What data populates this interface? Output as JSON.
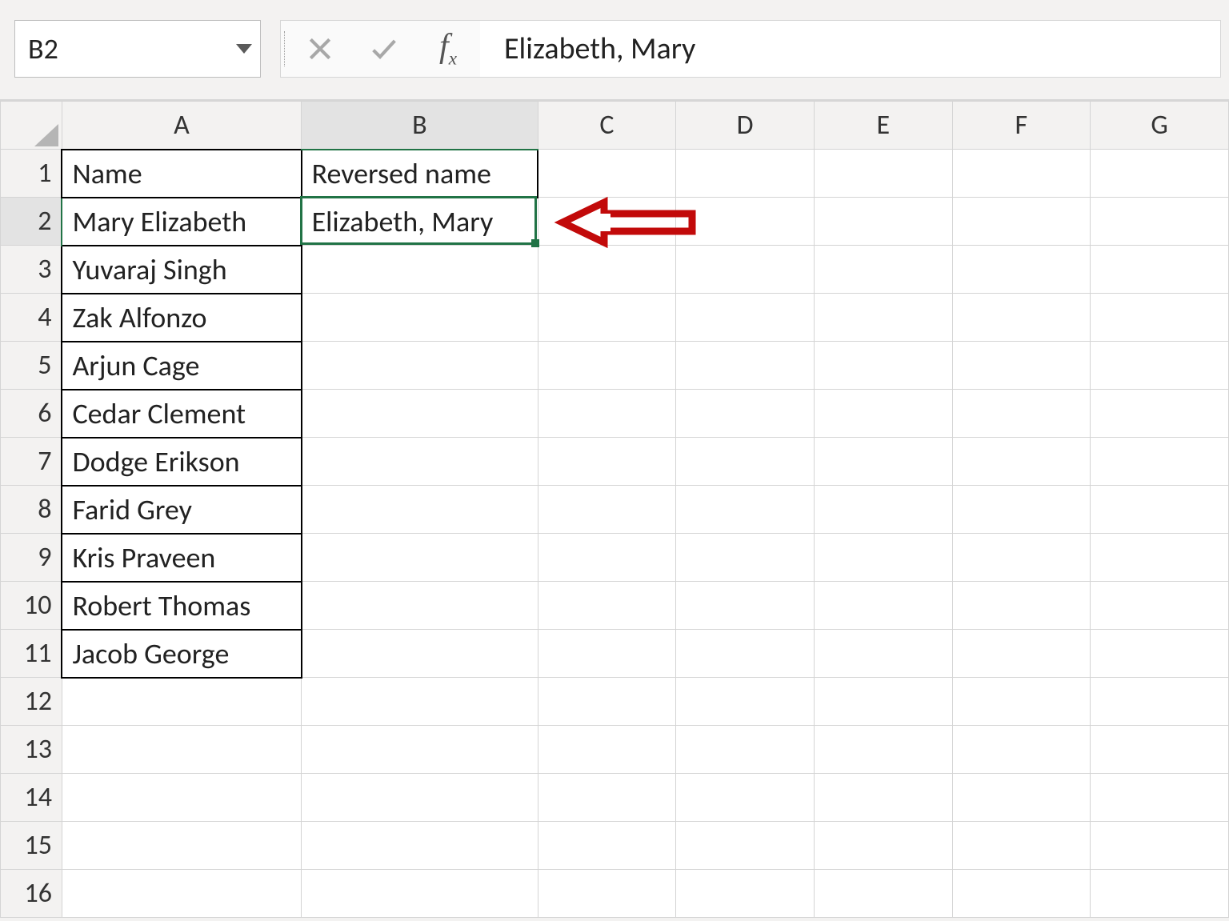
{
  "namebox": {
    "value": "B2"
  },
  "formula": {
    "value": "Elizabeth, Mary"
  },
  "columns": [
    "A",
    "B",
    "C",
    "D",
    "E",
    "F",
    "G"
  ],
  "rows": [
    1,
    2,
    3,
    4,
    5,
    6,
    7,
    8,
    9,
    10,
    11,
    12,
    13,
    14,
    15,
    16
  ],
  "active": {
    "col": "B",
    "row": 2
  },
  "table": {
    "header": {
      "A": "Name",
      "B": "Reversed name"
    },
    "data": {
      "A": [
        "Mary Elizabeth",
        "Yuvaraj Singh",
        "Zak Alfonzo",
        "Arjun Cage",
        "Cedar Clement",
        "Dodge Erikson",
        "Farid Grey",
        "Kris Praveen",
        "Robert Thomas",
        "Jacob George"
      ],
      "B": [
        "Elizabeth, Mary"
      ]
    }
  }
}
